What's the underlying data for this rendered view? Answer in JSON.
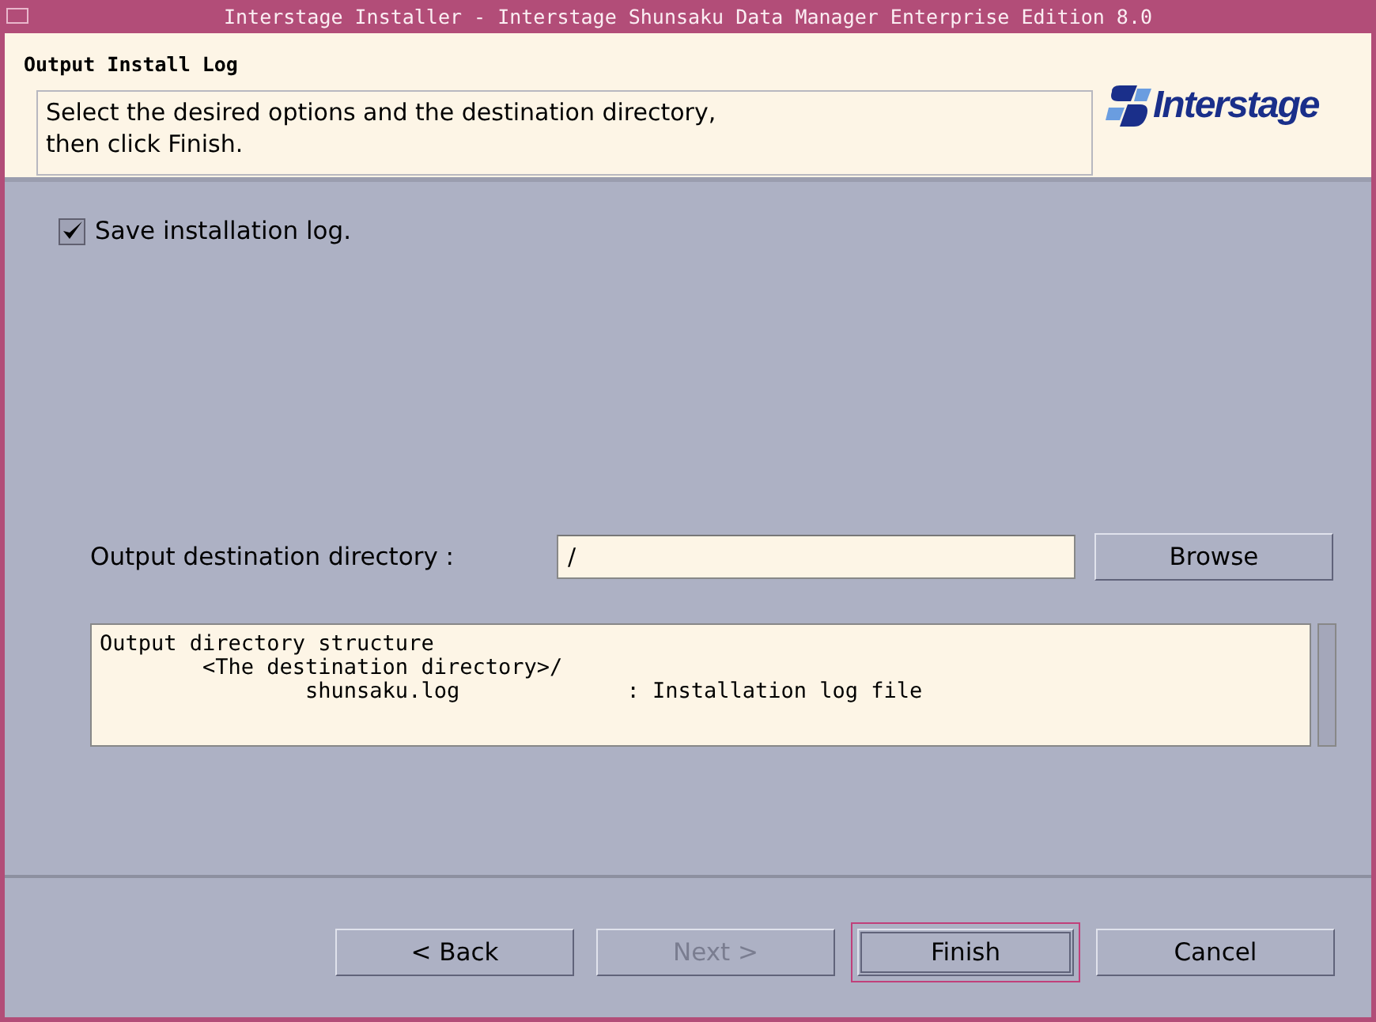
{
  "window": {
    "title": "Interstage Installer - Interstage Shunsaku Data Manager Enterprise Edition 8.0"
  },
  "header": {
    "title": "Output Install Log",
    "instructions": [
      "Select the desired options and the destination directory,",
      "then click Finish."
    ],
    "logo": "Interstage"
  },
  "save_log": {
    "label": "Save installation log.",
    "checked": true
  },
  "destination": {
    "label": "Output destination directory :",
    "value": "/",
    "browse": "Browse"
  },
  "structure": {
    "lines": [
      "Output directory structure",
      "        <The destination directory>/",
      "                shunsaku.log             : Installation log file"
    ]
  },
  "buttons": [
    {
      "label": "< Back",
      "disabled": false,
      "default": false
    },
    {
      "label": "Next >",
      "disabled": true,
      "default": false
    },
    {
      "label": "Finish",
      "disabled": false,
      "default": true
    },
    {
      "label": "Cancel",
      "disabled": false,
      "default": false
    }
  ]
}
